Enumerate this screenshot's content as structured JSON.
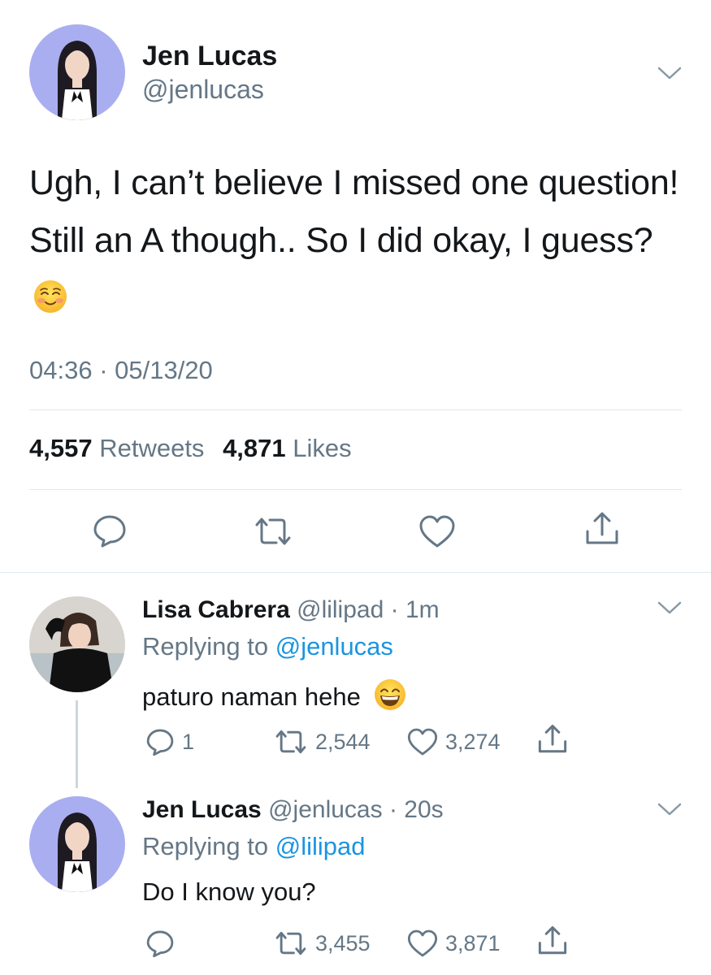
{
  "main_tweet": {
    "author_name": "Jen Lucas",
    "author_handle": "@jenlucas",
    "text": "Ugh, I can’t believe I missed one question! Still an A though.. So I did okay, I guess?",
    "emoji": "smiling-face-with-blush-emoji",
    "timestamp": "04:36 · 05/13/20",
    "retweets_count": "4,557",
    "retweets_label": "Retweets",
    "likes_count": "4,871",
    "likes_label": "Likes",
    "actions": [
      "reply-icon",
      "retweet-icon",
      "like-icon",
      "share-icon"
    ]
  },
  "replies": [
    {
      "author_name": "Lisa Cabrera",
      "author_handle": "@lilipad",
      "time": "· 1m",
      "replying_prefix": "Replying to",
      "replying_to": "@jenlucas",
      "text": "paturo naman hehe",
      "emoji": "grinning-face-emoji",
      "reply_count": "1",
      "retweet_count": "2,544",
      "like_count": "3,274"
    },
    {
      "author_name": "Jen Lucas",
      "author_handle": "@jenlucas",
      "time": "· 20s",
      "replying_prefix": "Replying to",
      "replying_to": "@lilipad",
      "text": "Do I know you?",
      "reply_count": "",
      "retweet_count": "3,455",
      "like_count": "3,871"
    }
  ],
  "colors": {
    "text": "#14171a",
    "muted": "#657786",
    "link": "#1b95e0",
    "divider": "#e1e8ed",
    "avatar_bg": "#a9aef0"
  }
}
